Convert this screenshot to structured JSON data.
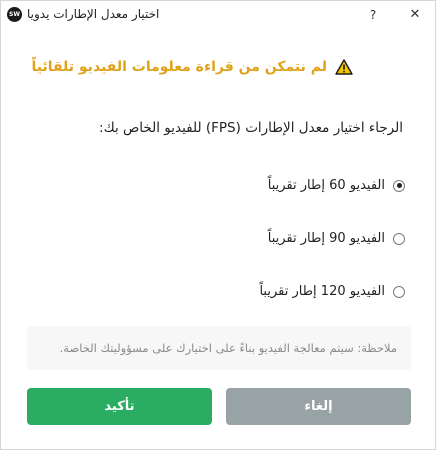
{
  "window": {
    "title": "اختيار معدل الإطارات يدويا",
    "app_icon_text": "SW",
    "help_label": "?",
    "close_label": "✕"
  },
  "warning": {
    "icon": "warning-triangle-icon",
    "text": "لم نتمكن من قراءة معلومات الفيديو تلقائياً",
    "color": "#e0a21a"
  },
  "instruction": "الرجاء اختيار معدل الإطارات (FPS) للفيديو الخاص بك:",
  "options": [
    {
      "label": "الفيديو 60 إطار تقريباً",
      "selected": true
    },
    {
      "label": "الفيديو 90 إطار تقريباً",
      "selected": false
    },
    {
      "label": "الفيديو 120 إطار تقريباً",
      "selected": false
    }
  ],
  "note": "ملاحظة: سيتم معالجة الفيديو بناءً على اختيارك على مسؤوليتك الخاصة.",
  "buttons": {
    "confirm_label": "تأكيد",
    "cancel_label": "إلغاء",
    "confirm_color": "#2aad63",
    "cancel_color": "#98a3a6"
  }
}
